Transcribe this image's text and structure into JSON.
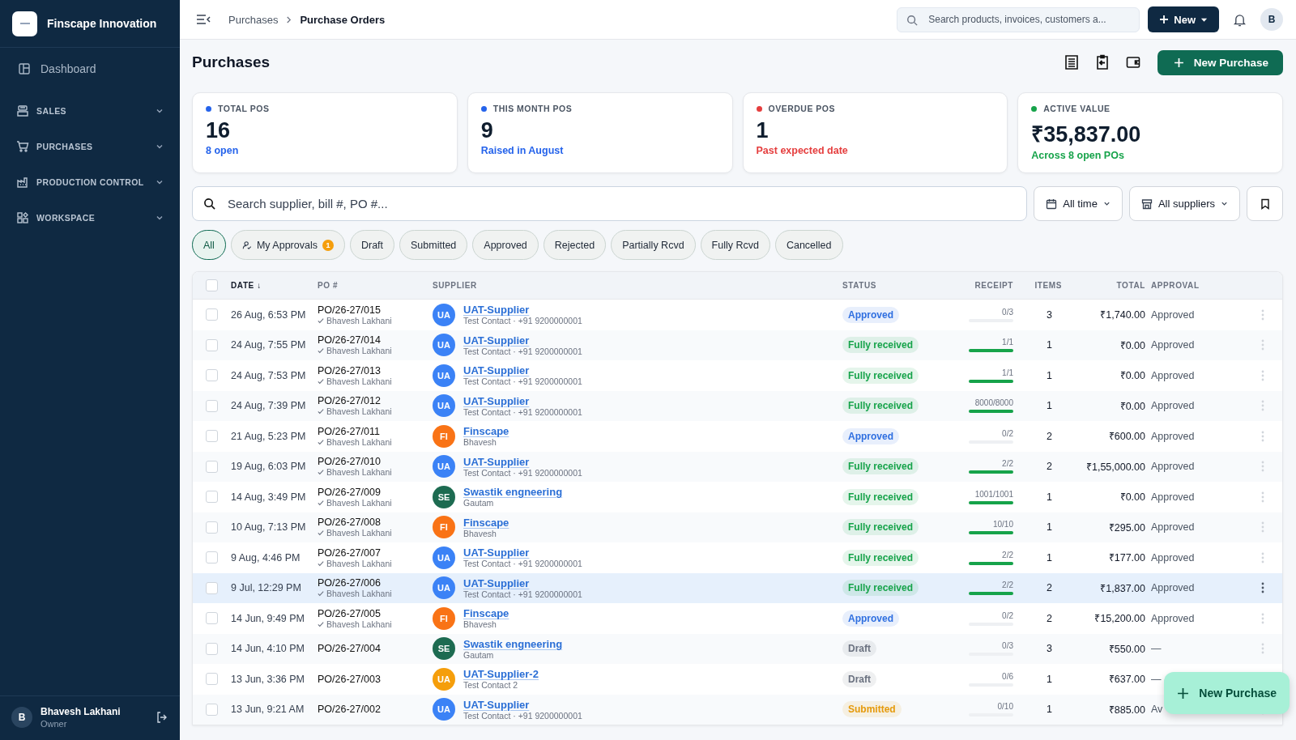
{
  "sidebar": {
    "brand": "Finscape Innovation",
    "items": [
      {
        "label": "Dashboard",
        "kind": "link"
      },
      {
        "label": "SALES",
        "kind": "section",
        "expanded": false
      },
      {
        "label": "PURCHASES",
        "kind": "section",
        "expanded": false
      },
      {
        "label": "PRODUCTION CONTROL",
        "kind": "section",
        "expanded": false
      },
      {
        "label": "WORKSPACE",
        "kind": "section",
        "expanded": false
      }
    ],
    "user": {
      "initial": "B",
      "name": "Bhavesh Lakhani",
      "role": "Owner"
    }
  },
  "topbar": {
    "breadcrumb": [
      "Purchases",
      "Purchase Orders"
    ],
    "search_placeholder": "Search products, invoices, customers a...",
    "new_button": "New",
    "avatar": "B"
  },
  "page": {
    "title": "Purchases",
    "primary_button": "New Purchase"
  },
  "stats": [
    {
      "label": "TOTAL POS",
      "value": "16",
      "note": "8 open",
      "color": "#2563eb"
    },
    {
      "label": "THIS MONTH POS",
      "value": "9",
      "note": "Raised in August",
      "color": "#2563eb"
    },
    {
      "label": "OVERDUE POS",
      "value": "1",
      "note": "Past expected date",
      "color": "#e53e3e"
    },
    {
      "label": "ACTIVE VALUE",
      "value": "₹35,837.00",
      "note": "Across 8 open POs",
      "color": "#16a34a"
    }
  ],
  "filters": {
    "search_placeholder": "Search supplier, bill #, PO #...",
    "time": "All time",
    "suppliers": "All suppliers"
  },
  "chips": [
    {
      "label": "All",
      "selected": true
    },
    {
      "label": "My Approvals",
      "badge": "1",
      "selected": false
    },
    {
      "label": "Draft",
      "selected": false
    },
    {
      "label": "Submitted",
      "selected": false
    },
    {
      "label": "Approved",
      "selected": false
    },
    {
      "label": "Rejected",
      "selected": false
    },
    {
      "label": "Partially Rcvd",
      "selected": false
    },
    {
      "label": "Fully Rcvd",
      "selected": false
    },
    {
      "label": "Cancelled",
      "selected": false
    }
  ],
  "table": {
    "select_all_checked": false,
    "columns": [
      "DATE ↓",
      "PO #",
      "SUPPLIER",
      "STATUS",
      "RECEIPT",
      "ITEMS",
      "TOTAL",
      "APPROVAL"
    ],
    "rows": [
      {
        "date": "26 Aug, 6:53 PM",
        "po": "PO/26-27/015",
        "approver": "Bhavesh Lakhani",
        "avatar": "UA",
        "color": "#3b82f6",
        "supplier": "UAT-Supplier",
        "contact": "Test Contact · +91 9200000001",
        "status": {
          "label": "Approved",
          "color": "#2f6fe0"
        },
        "receipt": "0/3",
        "level": 0,
        "items": "3",
        "total": "₹1,740.00",
        "approval": "Approved",
        "checked": false,
        "hovered": false
      },
      {
        "date": "24 Aug, 7:55 PM",
        "po": "PO/26-27/014",
        "approver": "Bhavesh Lakhani",
        "avatar": "UA",
        "color": "#3b82f6",
        "supplier": "UAT-Supplier",
        "contact": "Test Contact · +91 9200000001",
        "status": {
          "label": "Fully received",
          "color": "#16a34a"
        },
        "receipt": "1/1",
        "level": 1,
        "items": "1",
        "total": "₹0.00",
        "approval": "Approved",
        "checked": false,
        "hovered": false
      },
      {
        "date": "24 Aug, 7:53 PM",
        "po": "PO/26-27/013",
        "approver": "Bhavesh Lakhani",
        "avatar": "UA",
        "color": "#3b82f6",
        "supplier": "UAT-Supplier",
        "contact": "Test Contact · +91 9200000001",
        "status": {
          "label": "Fully received",
          "color": "#16a34a"
        },
        "receipt": "1/1",
        "level": 1,
        "items": "1",
        "total": "₹0.00",
        "approval": "Approved",
        "checked": false,
        "hovered": false
      },
      {
        "date": "24 Aug, 7:39 PM",
        "po": "PO/26-27/012",
        "approver": "Bhavesh Lakhani",
        "avatar": "UA",
        "color": "#3b82f6",
        "supplier": "UAT-Supplier",
        "contact": "Test Contact · +91 9200000001",
        "status": {
          "label": "Fully received",
          "color": "#16a34a"
        },
        "receipt": "8000/8000",
        "level": 1,
        "items": "1",
        "total": "₹0.00",
        "approval": "Approved",
        "checked": false,
        "hovered": false
      },
      {
        "date": "21 Aug, 5:23 PM",
        "po": "PO/26-27/011",
        "approver": "Bhavesh Lakhani",
        "avatar": "FI",
        "color": "#f97316",
        "supplier": "Finscape",
        "contact": "Bhavesh",
        "status": {
          "label": "Approved",
          "color": "#2f6fe0"
        },
        "receipt": "0/2",
        "level": 0,
        "items": "2",
        "total": "₹600.00",
        "approval": "Approved",
        "checked": false,
        "hovered": false
      },
      {
        "date": "19 Aug, 6:03 PM",
        "po": "PO/26-27/010",
        "approver": "Bhavesh Lakhani",
        "avatar": "UA",
        "color": "#3b82f6",
        "supplier": "UAT-Supplier",
        "contact": "Test Contact · +91 9200000001",
        "status": {
          "label": "Fully received",
          "color": "#16a34a"
        },
        "receipt": "2/2",
        "level": 1,
        "items": "2",
        "total": "₹1,55,000.00",
        "approval": "Approved",
        "checked": false,
        "hovered": false
      },
      {
        "date": "14 Aug, 3:49 PM",
        "po": "PO/26-27/009",
        "approver": "Bhavesh Lakhani",
        "avatar": "SE",
        "color": "#1d6b51",
        "supplier": "Swastik engneering",
        "contact": "Gautam",
        "status": {
          "label": "Fully received",
          "color": "#16a34a"
        },
        "receipt": "1001/1001",
        "level": 1,
        "items": "1",
        "total": "₹0.00",
        "approval": "Approved",
        "checked": false,
        "hovered": false
      },
      {
        "date": "10 Aug, 7:13 PM",
        "po": "PO/26-27/008",
        "approver": "Bhavesh Lakhani",
        "avatar": "FI",
        "color": "#f97316",
        "supplier": "Finscape",
        "contact": "Bhavesh",
        "status": {
          "label": "Fully received",
          "color": "#16a34a"
        },
        "receipt": "10/10",
        "level": 1,
        "items": "1",
        "total": "₹295.00",
        "approval": "Approved",
        "checked": false,
        "hovered": false
      },
      {
        "date": "9 Aug, 4:46 PM",
        "po": "PO/26-27/007",
        "approver": "Bhavesh Lakhani",
        "avatar": "UA",
        "color": "#3b82f6",
        "supplier": "UAT-Supplier",
        "contact": "Test Contact · +91 9200000001",
        "status": {
          "label": "Fully received",
          "color": "#16a34a"
        },
        "receipt": "2/2",
        "level": 1,
        "items": "1",
        "total": "₹177.00",
        "approval": "Approved",
        "checked": false,
        "hovered": false
      },
      {
        "date": "9 Jul, 12:29 PM",
        "po": "PO/26-27/006",
        "approver": "Bhavesh Lakhani",
        "avatar": "UA",
        "color": "#3b82f6",
        "supplier": "UAT-Supplier",
        "contact": "Test Contact · +91 9200000001",
        "status": {
          "label": "Fully received",
          "color": "#16a34a"
        },
        "receipt": "2/2",
        "level": 1,
        "items": "2",
        "total": "₹1,837.00",
        "approval": "Approved",
        "checked": false,
        "hovered": true
      },
      {
        "date": "14 Jun, 9:49 PM",
        "po": "PO/26-27/005",
        "approver": "Bhavesh Lakhani",
        "avatar": "FI",
        "color": "#f97316",
        "supplier": "Finscape",
        "contact": "Bhavesh",
        "status": {
          "label": "Approved",
          "color": "#2f6fe0"
        },
        "receipt": "0/2",
        "level": 0,
        "items": "2",
        "total": "₹15,200.00",
        "approval": "Approved",
        "checked": false,
        "hovered": false
      },
      {
        "date": "14 Jun, 4:10 PM",
        "po": "PO/26-27/004",
        "avatar": "SE",
        "color": "#1d6b51",
        "supplier": "Swastik engneering",
        "contact": "Gautam",
        "status": {
          "label": "Draft",
          "color": "#6b7280"
        },
        "receipt": "0/3",
        "level": 0,
        "items": "3",
        "total": "₹550.00",
        "approval": "—",
        "checked": false,
        "hovered": false
      },
      {
        "date": "13 Jun, 3:36 PM",
        "po": "PO/26-27/003",
        "avatar": "UA",
        "color": "#f59e0b",
        "supplier": "UAT-Supplier-2",
        "contact": "Test Contact 2",
        "status": {
          "label": "Draft",
          "color": "#6b7280"
        },
        "receipt": "0/6",
        "level": 0,
        "items": "1",
        "total": "₹637.00",
        "approval": "—",
        "checked": false,
        "hovered": false
      },
      {
        "date": "13 Jun, 9:21 AM",
        "po": "PO/26-27/002",
        "avatar": "UA",
        "color": "#3b82f6",
        "supplier": "UAT-Supplier",
        "contact": "Test Contact · +91 9200000001",
        "status": {
          "label": "Submitted",
          "color": "#e59a0b"
        },
        "receipt": "0/10",
        "level": 0,
        "items": "1",
        "total": "₹885.00",
        "approval": "Av",
        "checked": false,
        "hovered": false
      }
    ]
  },
  "fab": "New Purchase"
}
